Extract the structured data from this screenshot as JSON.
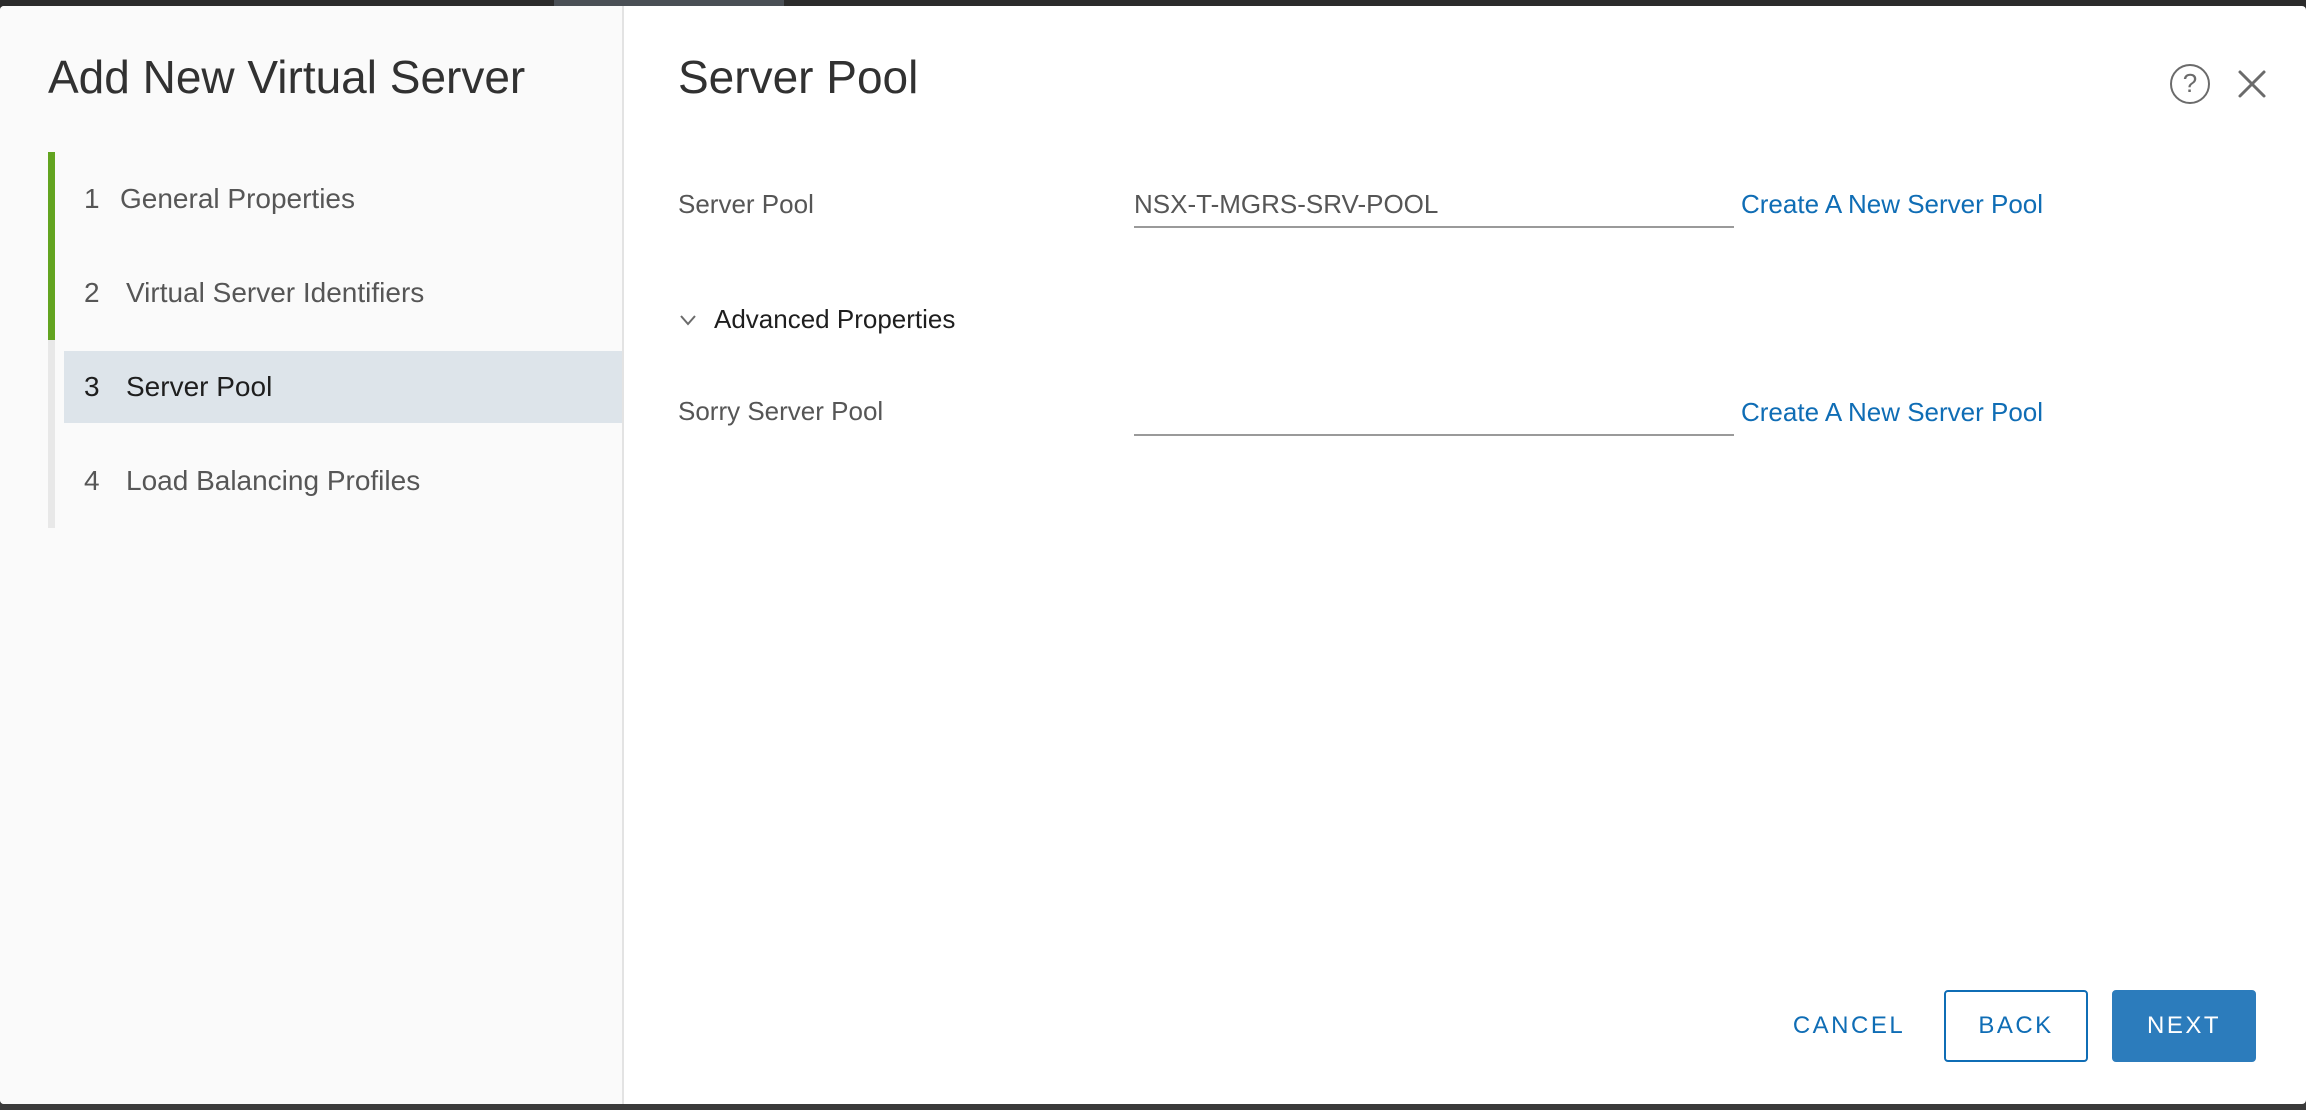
{
  "wizard": {
    "title": "Add New Virtual Server",
    "steps": [
      {
        "num": "1",
        "label": "General Properties"
      },
      {
        "num": "2",
        "label": "Virtual Server Identifiers"
      },
      {
        "num": "3",
        "label": "Server Pool"
      },
      {
        "num": "4",
        "label": "Load Balancing Profiles"
      }
    ]
  },
  "page": {
    "title": "Server Pool",
    "help_icon": "?",
    "fields": {
      "server_pool": {
        "label": "Server Pool",
        "value": "NSX-T-MGRS-SRV-POOL",
        "link": "Create A New Server Pool"
      },
      "advanced": {
        "label": "Advanced Properties"
      },
      "sorry_server_pool": {
        "label": "Sorry Server Pool",
        "value": "",
        "link": "Create A New Server Pool"
      }
    }
  },
  "footer": {
    "cancel": "CANCEL",
    "back": "BACK",
    "next": "NEXT"
  },
  "colors": {
    "accent": "#0f6db5",
    "primary_button": "#2c7cbc",
    "step_done": "#62a420",
    "step_active_bg": "#dde4ea"
  }
}
